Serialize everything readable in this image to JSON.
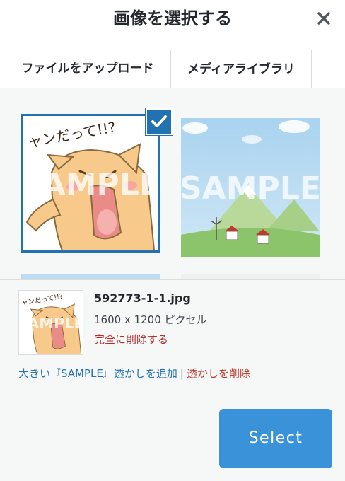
{
  "dialog": {
    "title": "画像を選択する"
  },
  "tabs": [
    {
      "label": "ファイルをアップロード",
      "active": false
    },
    {
      "label": "メディアライブラリ",
      "active": true
    }
  ],
  "library": {
    "items": [
      {
        "name": "cat-illustration",
        "selected": true,
        "watermark": "SAMPLE",
        "caption": "ャンだって!!?"
      },
      {
        "name": "landscape-illustration",
        "selected": false,
        "watermark": "SAMPLE"
      }
    ]
  },
  "attachment": {
    "filename": "592773-1-1.jpg",
    "dimensions": "1600 x 1200 ピクセル",
    "delete_label": "完全に削除する",
    "thumb_watermark": "SAMPLE",
    "thumb_caption": "ャンだって!!?"
  },
  "watermark_actions": {
    "add_label": "大きい『SAMPLE』透かしを追加",
    "separator": "|",
    "remove_label": "透かしを削除"
  },
  "footer": {
    "select_label": "Select"
  },
  "colors": {
    "accent": "#2271b1",
    "select_button": "#3a93d8",
    "danger": "#b32d2e"
  }
}
